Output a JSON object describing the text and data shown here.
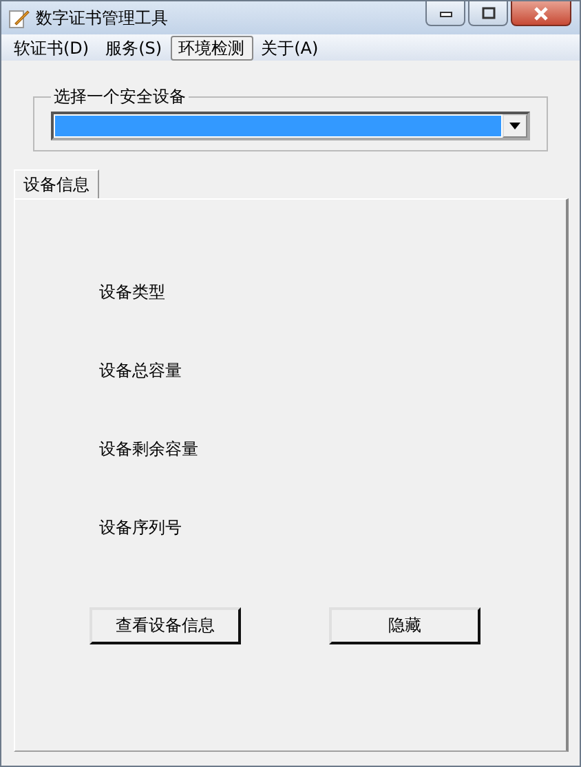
{
  "window": {
    "title": "数字证书管理工具"
  },
  "menu": [
    {
      "label": "软证书(D)",
      "selected": false
    },
    {
      "label": "服务(S)",
      "selected": false
    },
    {
      "label": "环境检测",
      "selected": true
    },
    {
      "label": "关于(A)",
      "selected": false
    }
  ],
  "device_group": {
    "title": "选择一个安全设备"
  },
  "tabs": [
    {
      "label": "设备信息",
      "selected": true
    }
  ],
  "fields": [
    "设备类型",
    "设备总容量",
    "设备剩余容量",
    "设备序列号"
  ],
  "buttons": [
    "查看设备信息",
    "隐藏"
  ]
}
